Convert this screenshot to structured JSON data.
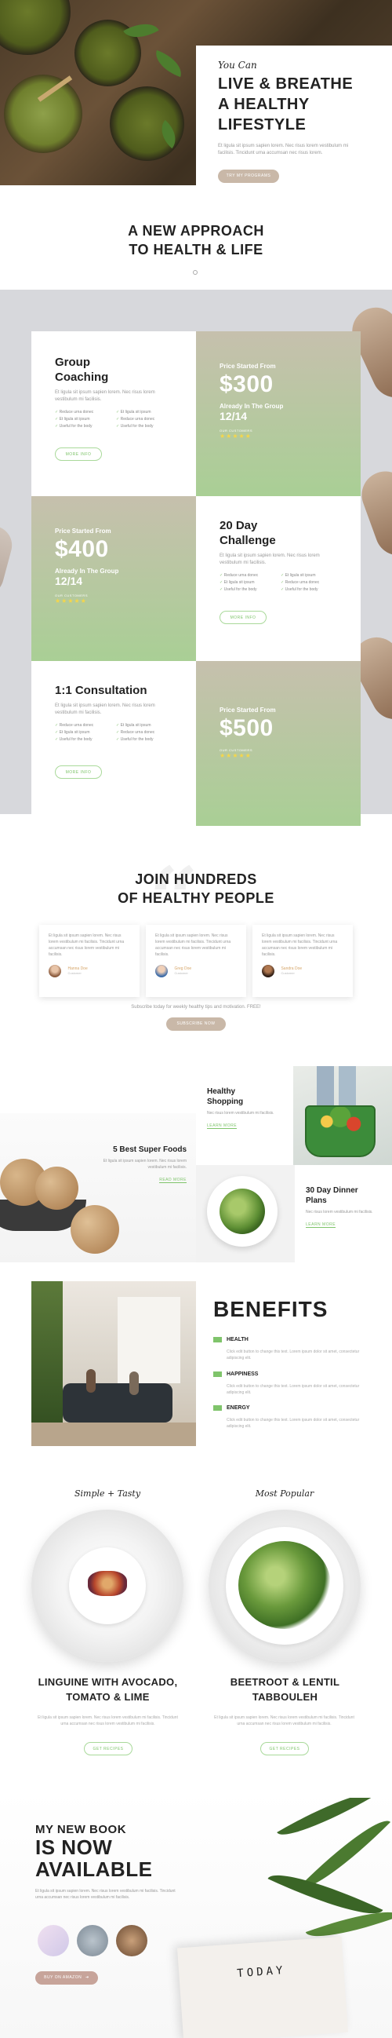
{
  "hero": {
    "script": "You Can",
    "title_line1": "LIVE & BREATHE",
    "title_line2": "A HEALTHY",
    "title_line3": "LIFESTYLE",
    "text": "Et ligula sit ipsum sapien lorem. Nec risus lorem vestibulum mi facilisis. Tincidunt urna accumsan nec risus lorem.",
    "button": "TRY MY PROGRAMS"
  },
  "approach": {
    "title_line1": "A NEW APPROACH",
    "title_line2": "TO HEALTH & LIFE"
  },
  "programs": [
    {
      "title": "Group Coaching",
      "text": "Et ligula sit ipsum sapien lorem. Nec risus lorem vestibulum mi facilisis.",
      "features": [
        "Reduce urna donec",
        "Et ligula sit ipsum",
        "Et ligula sit ipsum",
        "Reduce urna donec",
        "Useful for the body",
        "Useful for the body"
      ],
      "button": "MORE INFO",
      "price_label": "Price Started From",
      "price": "$300",
      "group_label": "Already In The Group",
      "group_count": "12/14",
      "lbl": "OUR CUSTOMERS"
    },
    {
      "title": "20 Day Challenge",
      "text": "Et ligula sit ipsum sapien lorem. Nec risus lorem vestibulum mi facilisis.",
      "features": [
        "Reduce urna donec",
        "Et ligula sit ipsum",
        "Et ligula sit ipsum",
        "Reduce urna donec",
        "Useful for the body",
        "Useful for the body"
      ],
      "button": "MORE INFO",
      "price_label": "Price Started From",
      "price": "$400",
      "group_label": "Already In The Group",
      "group_count": "12/14",
      "lbl": "OUR CUSTOMERS"
    },
    {
      "title": "1:1 Consultation",
      "text": "Et ligula sit ipsum sapien lorem. Nec risus lorem vestibulum mi facilisis.",
      "features": [
        "Reduce urna donec",
        "Et ligula sit ipsum",
        "Et ligula sit ipsum",
        "Reduce urna donec",
        "Useful for the body",
        "Useful for the body"
      ],
      "button": "MORE INFO",
      "price_label": "Price Started From",
      "price": "$500",
      "lbl": "OUR CUSTOMERS"
    }
  ],
  "stars": "★★★★★",
  "testimonials": {
    "title_line1": "JOIN HUNDREDS",
    "title_line2": "OF HEALTHY PEOPLE",
    "quote_mark": "“",
    "items": [
      {
        "text": "Et ligula sit ipsum sapien lorem. Nec risus lorem vestibulum mi facilisis. Tincidunt urna accumsan nec risus lorem vestibulum mi facilisis.",
        "name": "Hanna Doe",
        "role": "Customer"
      },
      {
        "text": "Et ligula sit ipsum sapien lorem. Nec risus lorem vestibulum mi facilisis. Tincidunt urna accumsan nec risus lorem vestibulum mi facilisis.",
        "name": "Greg Doe",
        "role": "Customer"
      },
      {
        "text": "Et ligula sit ipsum sapien lorem. Nec risus lorem vestibulum mi facilisis. Tincidunt urna accumsan nec risus lorem vestibulum mi facilisis.",
        "name": "Sandra Doe",
        "role": "Customer"
      }
    ],
    "subscribe_text": "Subscribe today for weekly healthy tips and motivation. FREE!",
    "subscribe_button": "SUBSCRIBE NOW"
  },
  "foods": {
    "shopping_title_line1": "Healthy",
    "shopping_title_line2": "Shopping",
    "shopping_text": "Nec risus lorem vestibulum mi facilisis.",
    "shopping_link": "LEARN MORE",
    "superfoods_title": "5 Best Super Foods",
    "superfoods_text": "Et ligula sit ipsum sapien lorem. Nec risus lorem vestibulum mi facilisis.",
    "superfoods_link": "READ MORE",
    "dinner_title_line1": "30 Day Dinner",
    "dinner_title_line2": "Plans",
    "dinner_text": "Nec risus lorem vestibulum mi facilisis.",
    "dinner_link": "LEARN MORE"
  },
  "benefits": {
    "title": "BENEFITS",
    "items": [
      {
        "title": "HEALTH",
        "text": "Click edit button to change this text. Lorem ipsum dolor sit amet, consectetur adipiscing elit."
      },
      {
        "title": "HAPPINESS",
        "text": "Click edit button to change this text. Lorem ipsum dolor sit amet, consectetur adipiscing elit."
      },
      {
        "title": "ENERGY",
        "text": "Click edit button to change this text. Lorem ipsum dolor sit amet, consectetur adipiscing elit."
      }
    ]
  },
  "recipes": [
    {
      "script": "Simple + Tasty",
      "title_line1": "LINGUINE WITH AVOCADO,",
      "title_line2": "TOMATO & LIME",
      "text": "Et ligula sit ipsum sapien lorem. Nec risus lorem vestibulum mi facilisis. Tincidunt urna accumsan nec risus lorem vestibulum mi facilisis.",
      "button": "GET RECIPES"
    },
    {
      "script": "Most Popular",
      "title_line1": "BEETROOT & LENTIL",
      "title_line2": "TABBOULEH",
      "text": "Et ligula sit ipsum sapien lorem. Nec risus lorem vestibulum mi facilisis. Tincidunt urna accumsan nec risus lorem vestibulum mi facilisis.",
      "button": "GET RECIPES"
    }
  ],
  "book": {
    "line1": "MY NEW BOOK",
    "line2": "IS NOW",
    "line3": "AVAILABLE",
    "text": "Et ligula sit ipsum sapien lorem. Nec risus lorem vestibulum mi facilisis. Tincidunt urna accumsan nec risus lorem vestibulum mi facilisis.",
    "button": "BUY ON AMAZON",
    "button_arrow": "➔",
    "cover_line1": "TODAY"
  }
}
